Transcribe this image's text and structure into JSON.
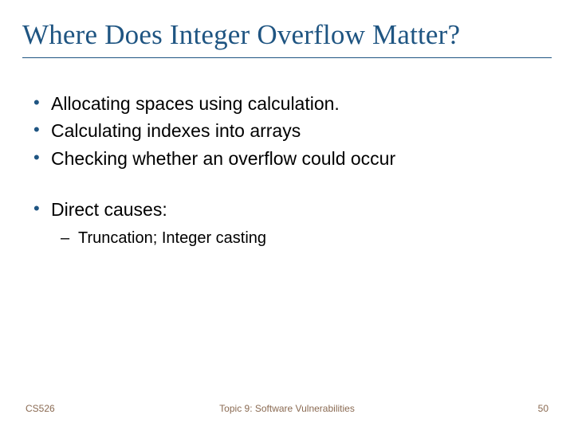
{
  "title": "Where Does Integer Overflow Matter?",
  "bullets": {
    "b1": "Allocating spaces using calculation.",
    "b2": "Calculating indexes into arrays",
    "b3": "Checking whether an overflow could occur",
    "b4": "Direct causes:",
    "sub1": "Truncation; Integer casting"
  },
  "footer": {
    "left": "CS526",
    "center": "Topic 9: Software Vulnerabilities",
    "right": "50"
  }
}
